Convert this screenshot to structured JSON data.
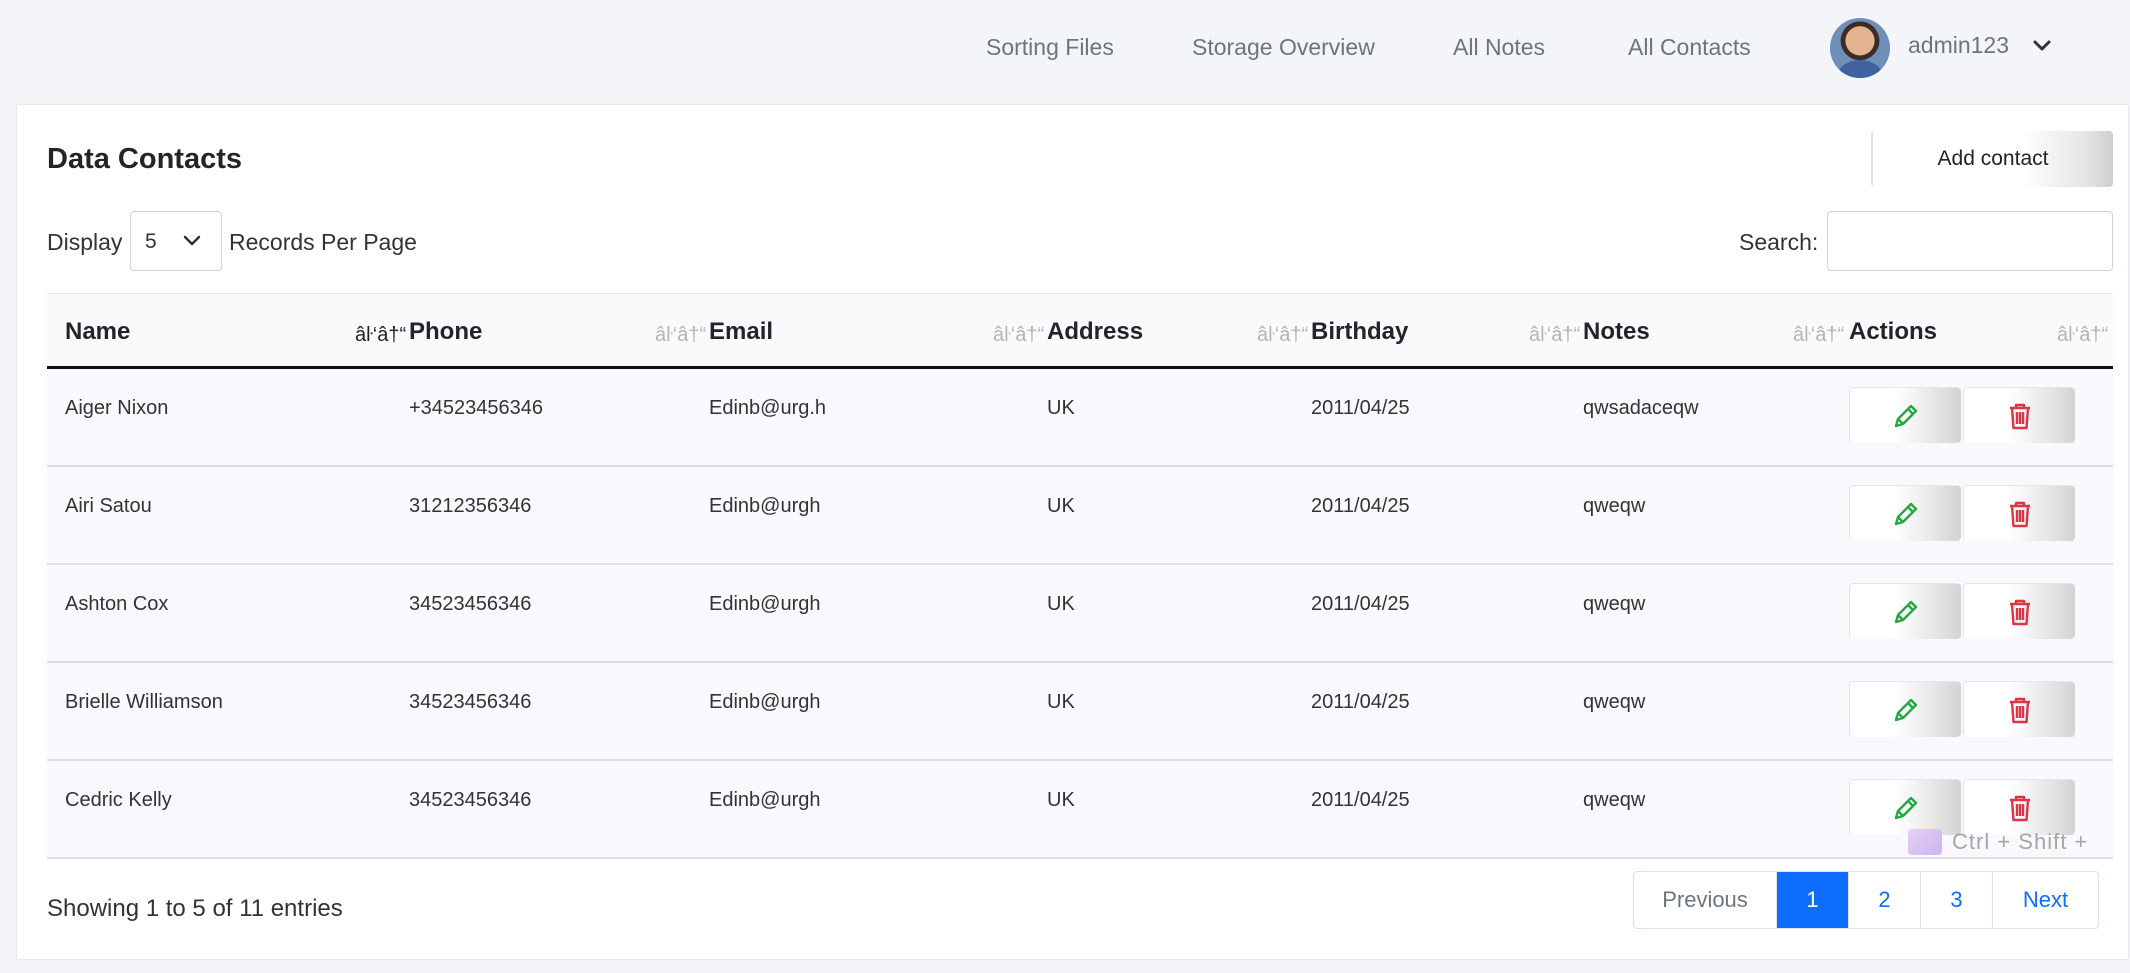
{
  "nav": {
    "links": [
      "Sorting Files",
      "Storage Overview",
      "All Notes",
      "All Contacts"
    ],
    "username": "admin123"
  },
  "card": {
    "title": "Data Contacts",
    "add_button": "Add contact",
    "display_label": "Display",
    "records_per_page": "5",
    "records_label": "Records Per Page",
    "search_label": "Search:",
    "search_value": ""
  },
  "table": {
    "headers": [
      "Name",
      "Phone",
      "Email",
      "Address",
      "Birthday",
      "Notes",
      "Actions"
    ],
    "sort_glyph": "âŀ‘â†“",
    "rows": [
      {
        "name": "Aiger Nixon",
        "phone": "+34523456346",
        "email": "Edinb@urg.h",
        "address": "UK",
        "birthday": "2011/04/25",
        "notes": "qwsadaceqw"
      },
      {
        "name": "Airi Satou",
        "phone": "31212356346",
        "email": "Edinb@urgh",
        "address": "UK",
        "birthday": "2011/04/25",
        "notes": "qweqw"
      },
      {
        "name": "Ashton Cox",
        "phone": "34523456346",
        "email": "Edinb@urgh",
        "address": "UK",
        "birthday": "2011/04/25",
        "notes": "qweqw"
      },
      {
        "name": "Brielle Williamson",
        "phone": "34523456346",
        "email": "Edinb@urgh",
        "address": "UK",
        "birthday": "2011/04/25",
        "notes": "qweqw"
      },
      {
        "name": "Cedric Kelly",
        "phone": "34523456346",
        "email": "Edinb@urgh",
        "address": "UK",
        "birthday": "2011/04/25",
        "notes": "qweqw"
      }
    ]
  },
  "footer": {
    "info": "Showing 1 to 5 of 11 entries",
    "pagination": [
      "Previous",
      "1",
      "2",
      "3",
      "Next"
    ],
    "active_page": "1",
    "shortcut_hint": "Ctrl + Shift +"
  },
  "colors": {
    "primary": "#0d6efd",
    "edit_icon": "#28a745",
    "delete_icon": "#dc3545"
  }
}
